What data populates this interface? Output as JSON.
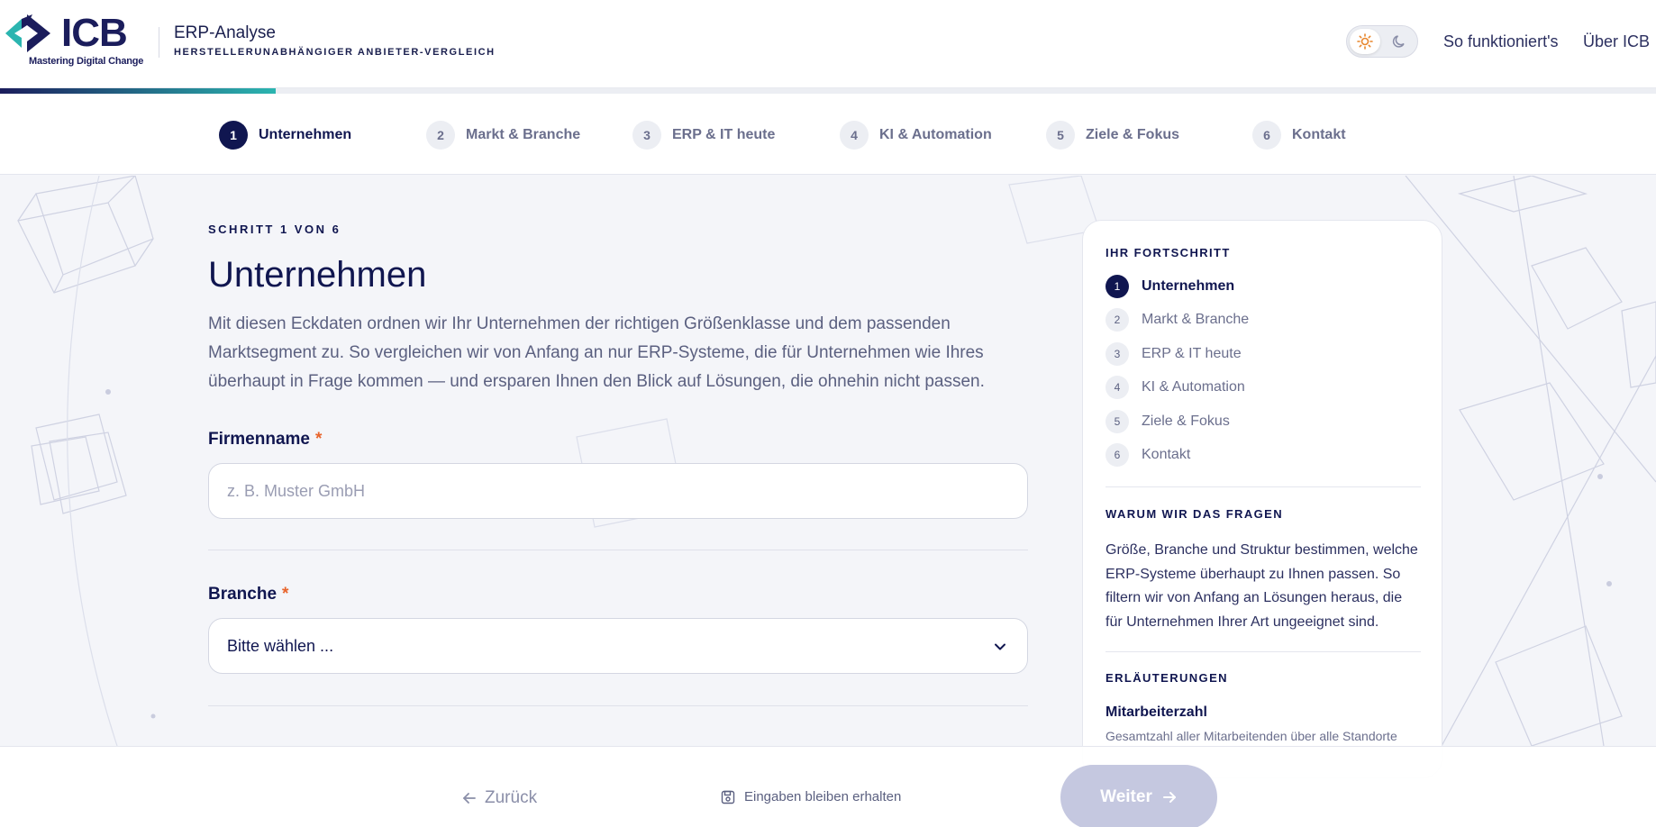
{
  "header": {
    "logo_text": "ICB",
    "logo_tagline": "Mastering Digital Change",
    "app_title": "ERP-Analyse",
    "app_subtitle": "HERSTELLERUNABHÄNGIGER ANBIETER-VERGLEICH",
    "theme_toggle": {
      "light_icon": "sun-icon",
      "dark_icon": "moon-icon",
      "selected": "light"
    },
    "nav": [
      {
        "label": "So funktioniert's"
      },
      {
        "label": "Über ICB"
      }
    ],
    "progress_fraction": 0.1667
  },
  "stepper": {
    "steps": [
      {
        "num": "1",
        "label": "Unternehmen",
        "active": true
      },
      {
        "num": "2",
        "label": "Markt & Branche",
        "active": false
      },
      {
        "num": "3",
        "label": "ERP & IT heute",
        "active": false
      },
      {
        "num": "4",
        "label": "KI & Automation",
        "active": false
      },
      {
        "num": "5",
        "label": "Ziele & Fokus",
        "active": false
      },
      {
        "num": "6",
        "label": "Kontakt",
        "active": false
      }
    ]
  },
  "main": {
    "step_counter": "SCHRITT 1 VON 6",
    "title": "Unternehmen",
    "intro": "Mit diesen Eckdaten ordnen wir Ihr Unternehmen der richtigen Größenklasse und dem passenden Marktsegment zu. So vergleichen wir von Anfang an nur ERP-Systeme, die für Unternehmen wie Ihres überhaupt in Frage kommen — und ersparen Ihnen den Blick auf Lösungen, die ohnehin nicht passen.",
    "fields": {
      "company_name": {
        "label": "Firmenname",
        "required_mark": "*",
        "placeholder": "z. B. Muster GmbH",
        "value": ""
      },
      "industry": {
        "label": "Branche",
        "required_mark": "*",
        "selected": "Bitte wählen ..."
      }
    }
  },
  "sidebar": {
    "progress_heading": "IHR FORTSCHRITT",
    "items": [
      {
        "num": "1",
        "label": "Unternehmen",
        "active": true
      },
      {
        "num": "2",
        "label": "Markt & Branche",
        "active": false
      },
      {
        "num": "3",
        "label": "ERP & IT heute",
        "active": false
      },
      {
        "num": "4",
        "label": "KI & Automation",
        "active": false
      },
      {
        "num": "5",
        "label": "Ziele & Fokus",
        "active": false
      },
      {
        "num": "6",
        "label": "Kontakt",
        "active": false
      }
    ],
    "why_heading": "WARUM WIR DAS FRAGEN",
    "why_text": "Größe, Branche und Struktur bestimmen, welche ERP-Systeme überhaupt zu Ihnen passen. So filtern wir von Anfang an Lösungen heraus, die für Unternehmen Ihrer Art ungeeignet sind.",
    "explain_heading": "ERLÄUTERUNGEN",
    "explain_term": "Mitarbeiterzahl",
    "explain_desc": "Gesamtzahl aller Mitarbeitenden über alle Standorte"
  },
  "footer": {
    "back_label": "Zurück",
    "save_note": "Eingaben bleiben erhalten",
    "next_label": "Weiter"
  },
  "colors": {
    "navy": "#101650",
    "accent_teal": "#2bb5b0",
    "required": "#e8642c",
    "next_disabled": "#c5c8e0"
  }
}
